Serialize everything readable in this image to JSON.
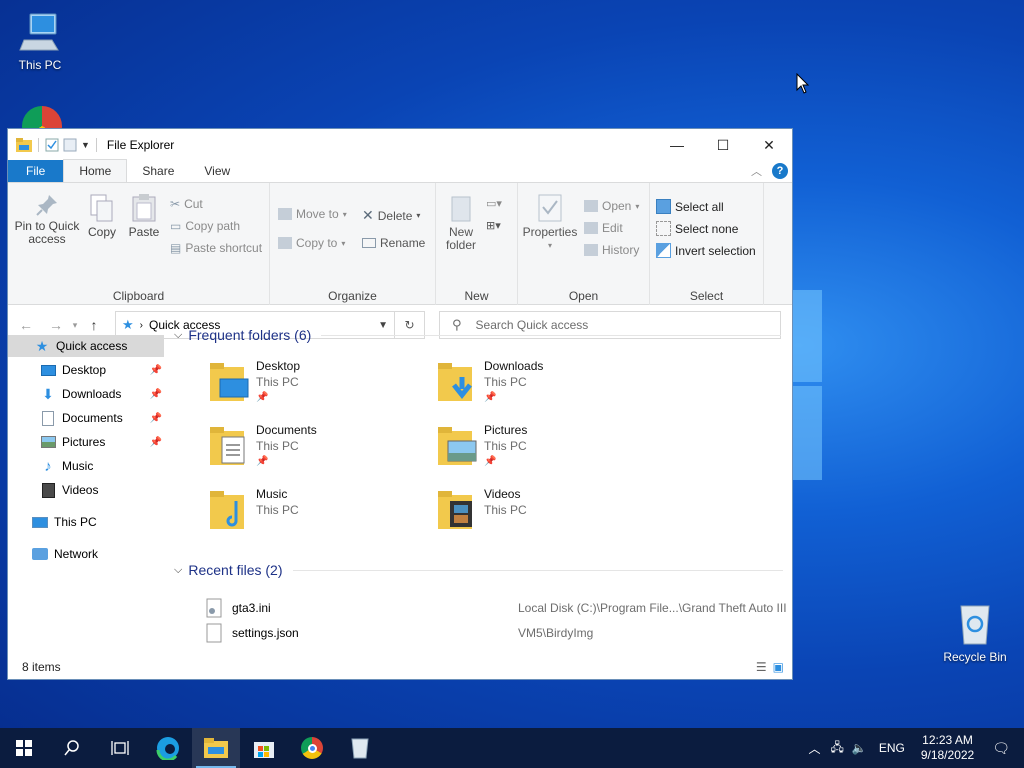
{
  "desktop": {
    "icons": [
      {
        "label": "This PC"
      },
      {
        "label": "Recycle Bin"
      }
    ]
  },
  "window": {
    "title": "File Explorer",
    "tabs": [
      "File",
      "Home",
      "Share",
      "View"
    ],
    "ribbon": {
      "clipboard": {
        "label": "Clipboard",
        "pin": "Pin to Quick access",
        "copy": "Copy",
        "paste": "Paste",
        "cut": "Cut",
        "copy_path": "Copy path",
        "paste_shortcut": "Paste shortcut"
      },
      "organize": {
        "label": "Organize",
        "move_to": "Move to",
        "copy_to": "Copy to",
        "delete": "Delete",
        "rename": "Rename"
      },
      "new": {
        "label": "New",
        "new_folder": "New folder"
      },
      "open": {
        "label": "Open",
        "properties": "Properties",
        "open": "Open",
        "edit": "Edit",
        "history": "History"
      },
      "select": {
        "label": "Select",
        "select_all": "Select all",
        "select_none": "Select none",
        "invert": "Invert selection"
      }
    },
    "address": {
      "path": "Quick access",
      "search_placeholder": "Search Quick access"
    },
    "nav_pane": [
      {
        "label": "Quick access",
        "icon": "star-icon"
      },
      {
        "label": "Desktop",
        "icon": "desktop-icon",
        "pinned": true
      },
      {
        "label": "Downloads",
        "icon": "downloads-icon",
        "pinned": true
      },
      {
        "label": "Documents",
        "icon": "documents-icon",
        "pinned": true
      },
      {
        "label": "Pictures",
        "icon": "pictures-icon",
        "pinned": true
      },
      {
        "label": "Music",
        "icon": "music-icon"
      },
      {
        "label": "Videos",
        "icon": "videos-icon"
      },
      {
        "label": "This PC",
        "icon": "computer-icon"
      },
      {
        "label": "Network",
        "icon": "network-icon"
      }
    ],
    "frequent": {
      "heading": "Frequent folders (6)",
      "folders": [
        {
          "name": "Desktop",
          "location": "This PC",
          "pinned": true
        },
        {
          "name": "Downloads",
          "location": "This PC",
          "pinned": true
        },
        {
          "name": "Documents",
          "location": "This PC",
          "pinned": true
        },
        {
          "name": "Pictures",
          "location": "This PC",
          "pinned": true
        },
        {
          "name": "Music",
          "location": "This PC",
          "pinned": false
        },
        {
          "name": "Videos",
          "location": "This PC",
          "pinned": false
        }
      ]
    },
    "recent": {
      "heading": "Recent files (2)",
      "files": [
        {
          "name": "gta3.ini",
          "path": "Local Disk (C:)\\Program File...\\Grand Theft Auto III"
        },
        {
          "name": "settings.json",
          "path": "VM5\\BirdyImg"
        }
      ]
    },
    "status": {
      "items": "8 items"
    }
  },
  "taskbar": {
    "language": "ENG",
    "time": "12:23 AM",
    "date": "9/18/2022"
  },
  "colors": {
    "accent": "#1979ca",
    "taskbar": "#0b1c3f",
    "folder": "#f2c94c",
    "heading": "#1e3287"
  }
}
